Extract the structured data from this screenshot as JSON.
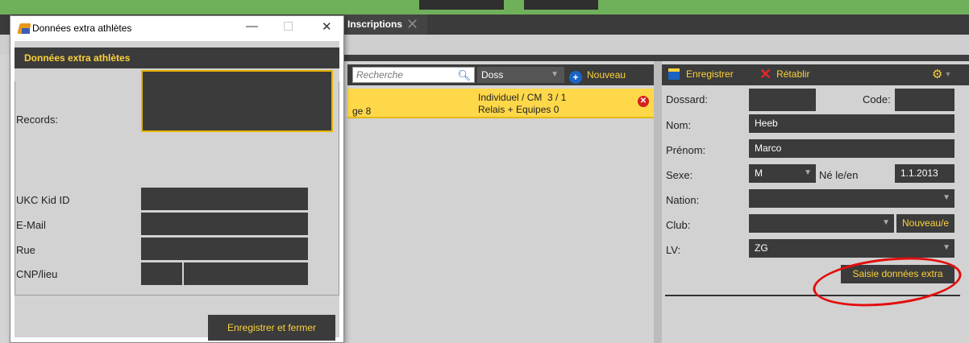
{
  "app": {
    "tab_label": "Inscriptions",
    "tab_close": "✕"
  },
  "list": {
    "search_placeholder": "Recherche",
    "sort_selected": "Doss",
    "new_label": "Nouveau",
    "row": {
      "partial_text": "ge 8",
      "line1_label": "Individuel / CM",
      "line1_value": "3 / 1",
      "line2_label": "Relais + Equipes",
      "line2_value": "0"
    }
  },
  "form": {
    "save_label": "Enregistrer",
    "reset_label": "Rétablir",
    "labels": {
      "dossard": "Dossard:",
      "code": "Code:",
      "nom": "Nom:",
      "prenom": "Prénom:",
      "sexe": "Sexe:",
      "ne": "Né le/en",
      "nation": "Nation:",
      "club": "Club:",
      "lv": "LV:"
    },
    "values": {
      "dossard": "",
      "code": "",
      "nom": "Heeb",
      "prenom": "Marco",
      "sexe": "M",
      "ne": "1.1.2013",
      "nation": "",
      "club": "",
      "lv": "ZG"
    },
    "club_new_label": "Nouveau/e",
    "extra_button": "Saisie données extra"
  },
  "dialog": {
    "window_title": "Données extra athlètes",
    "header": "Données extra athlètes",
    "labels": {
      "records": "Records:",
      "ukc": "UKC Kid ID",
      "email": "E-Mail",
      "rue": "Rue",
      "cnp": "CNP/lieu"
    },
    "save_close": "Enregistrer et fermer"
  },
  "colors": {
    "accent": "#fcd23a",
    "highlight_circle": "#e30e0e",
    "panel_dark": "#3b3b3b"
  }
}
